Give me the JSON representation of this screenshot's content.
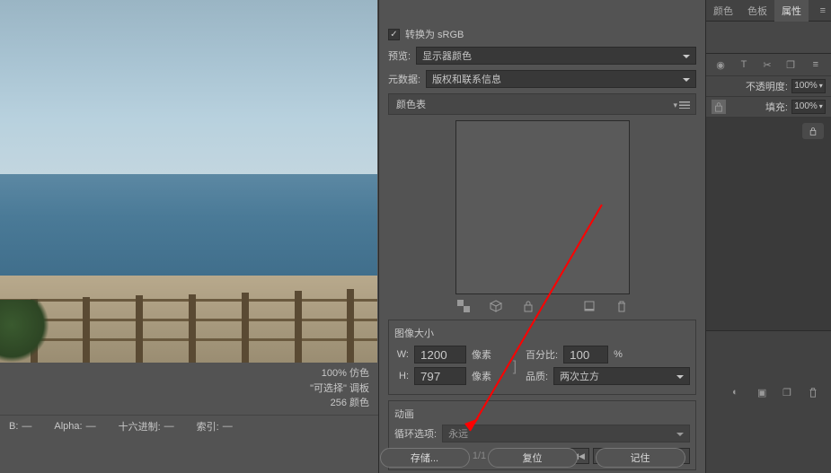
{
  "convert": {
    "checkbox_label": "转换为 sRGB"
  },
  "preview": {
    "label": "预览:",
    "value": "显示器颜色"
  },
  "metadata": {
    "label": "元数据:",
    "value": "版权和联系信息"
  },
  "color_table": {
    "title": "颜色表"
  },
  "image_size": {
    "title": "图像大小",
    "w_label": "W:",
    "w_value": "1200",
    "w_unit": "像素",
    "h_label": "H:",
    "h_value": "797",
    "h_unit": "像素",
    "percent_label": "百分比:",
    "percent_value": "100",
    "percent_unit": "%",
    "quality_label": "品质:",
    "quality_value": "两次立方"
  },
  "animation": {
    "title": "动画",
    "loop_label": "循环选项:",
    "loop_value": "永远",
    "page": "1/1"
  },
  "preview_info": {
    "line1": "100% 仿色",
    "line2": "\"可选择\" 调板",
    "line3": "256 颜色"
  },
  "info_bar": {
    "b_label": "B:",
    "b_value": "—",
    "alpha_label": "Alpha:",
    "alpha_value": "—",
    "hex_label": "十六进制:",
    "hex_value": "—",
    "index_label": "索引:",
    "index_value": "—"
  },
  "buttons": {
    "save": "存储...",
    "reset": "复位",
    "remember": "记住"
  },
  "right_panel": {
    "tabs": {
      "color": "颜色",
      "swatches": "色板",
      "properties": "属性"
    },
    "opacity_label": "不透明度:",
    "opacity_value": "100%",
    "fill_label": "填充:",
    "fill_value": "100%"
  }
}
